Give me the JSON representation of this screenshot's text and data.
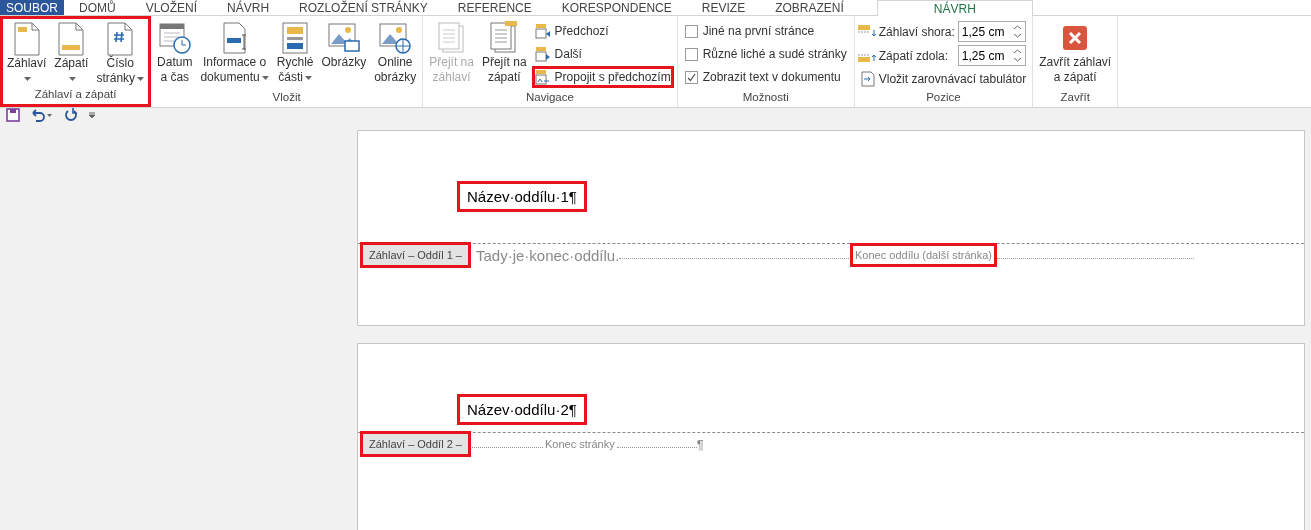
{
  "tabs": [
    {
      "label": "SOUBOR",
      "kind": "file",
      "selected": false
    },
    {
      "label": "DOMŮ",
      "kind": "normal",
      "selected": false
    },
    {
      "label": "VLOŽENÍ",
      "kind": "normal",
      "selected": false
    },
    {
      "label": "NÁVRH",
      "kind": "normal",
      "selected": false
    },
    {
      "label": "ROZLOŽENÍ STRÁNKY",
      "kind": "normal",
      "selected": false
    },
    {
      "label": "REFERENCE",
      "kind": "normal",
      "selected": false
    },
    {
      "label": "KORESPONDENCE",
      "kind": "normal",
      "selected": false
    },
    {
      "label": "REVIZE",
      "kind": "normal",
      "selected": false
    },
    {
      "label": "ZOBRAZENÍ",
      "kind": "normal",
      "selected": false
    },
    {
      "label": "NÁVRH",
      "kind": "contextual",
      "selected": true
    }
  ],
  "ribbon": {
    "groups": [
      {
        "title": "Záhlaví a zápatí",
        "highlighted": true,
        "items": [
          {
            "kind": "large",
            "lines": [
              "Záhlaví"
            ],
            "menu": true,
            "disabled": false
          },
          {
            "kind": "large",
            "lines": [
              "Zápatí"
            ],
            "menu": true,
            "disabled": false
          },
          {
            "kind": "large",
            "lines": [
              "Číslo",
              "stránky"
            ],
            "menu": true,
            "disabled": false
          }
        ]
      },
      {
        "title": "Vložit",
        "highlighted": false,
        "items": [
          {
            "kind": "large",
            "lines": [
              "Datum",
              "a čas"
            ],
            "menu": false,
            "disabled": false
          },
          {
            "kind": "large",
            "lines": [
              "Informace o",
              "dokumentu"
            ],
            "menu": true,
            "disabled": false
          },
          {
            "kind": "large",
            "lines": [
              "Rychlé",
              "části"
            ],
            "menu": true,
            "disabled": false
          },
          {
            "kind": "large",
            "lines": [
              "Obrázky"
            ],
            "menu": false,
            "disabled": false
          },
          {
            "kind": "large",
            "lines": [
              "Online",
              "obrázky"
            ],
            "menu": false,
            "disabled": false
          }
        ]
      },
      {
        "title": "Navigace",
        "highlighted": false,
        "items": [
          {
            "kind": "large",
            "lines": [
              "Přejít na",
              "záhlaví"
            ],
            "menu": false,
            "disabled": true
          },
          {
            "kind": "large",
            "lines": [
              "Přejít na",
              "zápatí"
            ],
            "menu": false,
            "disabled": false
          },
          {
            "kind": "stack",
            "rows": [
              {
                "label": "Předchozí",
                "highlighted": false
              },
              {
                "label": "Další",
                "highlighted": false
              },
              {
                "label": "Propojit s předchozím",
                "highlighted": true
              }
            ]
          }
        ]
      },
      {
        "title": "Možnosti",
        "highlighted": false,
        "items": [
          {
            "kind": "checks",
            "rows": [
              {
                "label": "Jiné na první stránce",
                "checked": false
              },
              {
                "label": "Různé liché a sudé stránky",
                "checked": false
              },
              {
                "label": "Zobrazit text v dokumentu",
                "checked": true
              }
            ]
          }
        ]
      },
      {
        "title": "Pozice",
        "highlighted": false,
        "items": [
          {
            "kind": "position",
            "spins": [
              {
                "label": "Záhlaví shora:",
                "value": "1,25 cm"
              },
              {
                "label": "Zápatí zdola:",
                "value": "1,25 cm"
              }
            ],
            "button": "Vložit zarovnávací tabulátor"
          }
        ]
      },
      {
        "title": "Zavřít",
        "highlighted": false,
        "items": [
          {
            "kind": "large",
            "lines": [
              "Zavřít záhlaví",
              "a zápatí"
            ],
            "menu": false,
            "disabled": false
          }
        ]
      }
    ]
  },
  "pages": [
    {
      "heading": "Název·oddílu·1¶",
      "heading_highlighted": true,
      "header_tag": "Záhlaví – Oddíl 1 –",
      "tag_highlighted": true,
      "body_text": "Tady·je·konec·oddílu.",
      "break_label": "Konec oddílu (další stránka)",
      "break_highlighted": true
    },
    {
      "heading": "Název·oddílu·2¶",
      "heading_highlighted": true,
      "header_tag": "Záhlaví – Oddíl 2 –",
      "tag_highlighted": true,
      "break_label": "Konec stránky",
      "break_end": "¶",
      "break_highlighted": false
    }
  ]
}
